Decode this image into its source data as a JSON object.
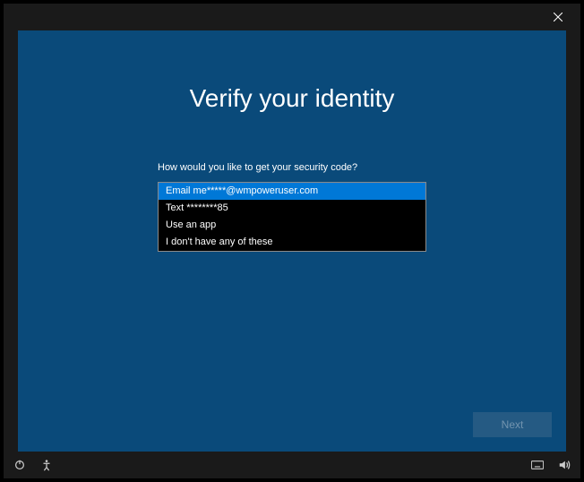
{
  "titlebar": {
    "close_tooltip": "Close"
  },
  "main": {
    "heading": "Verify your identity",
    "prompt": "How would you like to get your security code?",
    "options": [
      "Email me*****@wmpoweruser.com",
      "Text ********85",
      "Use an app",
      "I don't have any of these"
    ],
    "selected_index": 0,
    "next_label": "Next"
  },
  "taskbar": {
    "icons_left": [
      "power-icon",
      "ease-of-access-icon"
    ],
    "icons_right": [
      "keyboard-icon",
      "volume-icon"
    ]
  }
}
